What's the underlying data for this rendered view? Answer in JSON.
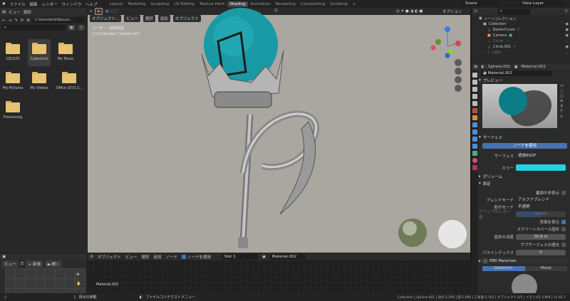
{
  "menu": {
    "items": [
      "ファイル",
      "編集",
      "レンダー",
      "ウィンドウ",
      "ヘルプ"
    ]
  },
  "workspaces": {
    "tabs": [
      "Layout",
      "Modeling",
      "Sculpting",
      "UV Editing",
      "Texture Paint",
      "Shading",
      "Animation",
      "Rendering",
      "Compositing",
      "Scripting"
    ],
    "active": "Shading",
    "add": "+"
  },
  "scene": {
    "name": "Scene",
    "view_layer": "View Layer"
  },
  "file_browser": {
    "header": [
      "ビュー",
      "選択"
    ],
    "path": "C:\\Users\\kreit\\Docum...",
    "search_placeholder": "",
    "folders": [
      "CELSYS",
      "CyberLink",
      "My Music",
      "My Pictures",
      "My Videos",
      "Office (D:D,2...",
      "Processing"
    ],
    "selected": "CyberLink"
  },
  "viewport": {
    "mode": "オブジェクト...",
    "menus": [
      "ビュー",
      "選択",
      "追加",
      "オブジェクト"
    ],
    "transform": "グロー...",
    "options": "オプション",
    "info_line1": "ユーザー・透視投影",
    "info_line2": "(1) Collection | Sphere.001"
  },
  "outliner": {
    "root": "シーンコレクション",
    "items": [
      {
        "name": "Collection",
        "dim": false
      },
      {
        "name": "BezierCurve",
        "dim": false
      },
      {
        "name": "Camera",
        "dim": false
      },
      {
        "name": "Circle",
        "dim": true
      },
      {
        "name": "Circle.001",
        "dim": false
      },
      {
        "name": "Light",
        "dim": true
      }
    ]
  },
  "properties": {
    "object": "Sphere.001",
    "material": "Material.002",
    "slot_material": "Material.002",
    "preview": "プレビュー",
    "surface_section": "サーフェス",
    "use_nodes": "ノードを使用",
    "surface_label": "サーフェス",
    "surface_value": "透過BSDF",
    "color_label": "カラー",
    "color": "#1fd3e0",
    "volume": "ボリューム",
    "settings": "設定",
    "backface": "裏面の非表示",
    "blend_label": "ブレンドモード",
    "blend_value": "アルファブレンド",
    "shadow_label": "影のモード",
    "shadow_value": "不透明",
    "clip_label": "クリップのしきい値",
    "clip_value": "0.500",
    "show_backface": "背面を表示",
    "show_backface_on": true,
    "ssr": "スクリーンスペース屈折",
    "ssr_on": false,
    "refr_label": "屈折の深度",
    "refr_value": "30.8 m",
    "sss": "サブサーフェスの透光",
    "sss_on": false,
    "pass_label": "パスインデックス",
    "pass_value": "0",
    "pbr": "PBR Materials",
    "pbr_tabs": [
      "Dielectric",
      "Metal"
    ]
  },
  "node_editor": {
    "mode": "オブジェクト",
    "menus": [
      "ビュー",
      "選択",
      "追加",
      "ノード"
    ],
    "use_nodes": "ノードを使用",
    "use_nodes_on": true,
    "slot": "Slot 1",
    "material": "Material.002",
    "label": "Material.002"
  },
  "image_editor": {
    "view": "ビュー",
    "new": "新規",
    "open": "開く"
  },
  "status": {
    "left": "",
    "middle": "視点の移動",
    "context": "ファイルコンテクストメニュー",
    "stats": "Collection | Sphere.001 | 頂点:2,568 | 面:2,680 | 三角面:5,162 | オブジェクト:0/5 | メモリ:61.3 MiB | v2.82.7"
  },
  "colors": {
    "accent": "#4772b3",
    "teal": "#1a9aa5",
    "viewport_bg": "#a8a69f"
  }
}
